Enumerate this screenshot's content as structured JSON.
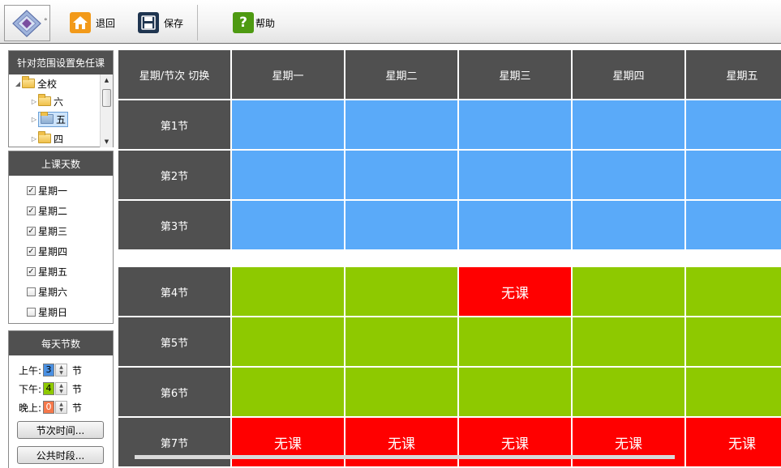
{
  "toolbar": {
    "back_label": "退回",
    "save_label": "保存",
    "help_label": "帮助",
    "logo_dot": "°"
  },
  "scope_panel": {
    "title": "针对范围设置免任课",
    "tree": [
      {
        "label": "全校",
        "level": 0,
        "expanded": true,
        "selected": false
      },
      {
        "label": "六",
        "level": 1,
        "expanded": false,
        "selected": false
      },
      {
        "label": "五",
        "level": 1,
        "expanded": false,
        "selected": true
      },
      {
        "label": "四",
        "level": 1,
        "expanded": false,
        "selected": false
      }
    ]
  },
  "days_panel": {
    "title": "上课天数",
    "days": [
      {
        "label": "星期一",
        "checked": true
      },
      {
        "label": "星期二",
        "checked": true
      },
      {
        "label": "星期三",
        "checked": true
      },
      {
        "label": "星期四",
        "checked": true
      },
      {
        "label": "星期五",
        "checked": true
      },
      {
        "label": "星期六",
        "checked": false
      },
      {
        "label": "星期日",
        "checked": false
      }
    ]
  },
  "periods_panel": {
    "title": "每天节数",
    "unit": "节",
    "rows": [
      {
        "label": "上午:",
        "value": "3",
        "color": "#4a90e2"
      },
      {
        "label": "下午:",
        "value": "4",
        "color": "#8ec900"
      },
      {
        "label": "晚上:",
        "value": "0",
        "color": "#f5784a"
      }
    ],
    "period_time_button": "节次时间...",
    "public_slot_button": "公共时段..."
  },
  "grid": {
    "corner_label": "星期/节次 切换",
    "columns": [
      "星期一",
      "星期二",
      "星期三",
      "星期四",
      "星期五"
    ],
    "no_class_label": "无课",
    "colors": {
      "morning": "#5aaaf9",
      "afternoon": "#8ec900",
      "no_class": "#ff0000",
      "header": "#505050"
    },
    "rows": [
      {
        "label": "第1节",
        "block": "morning",
        "cells": [
          "",
          "",
          "",
          "",
          ""
        ]
      },
      {
        "label": "第2节",
        "block": "morning",
        "cells": [
          "",
          "",
          "",
          "",
          ""
        ]
      },
      {
        "label": "第3节",
        "block": "morning",
        "cells": [
          "",
          "",
          "",
          "",
          ""
        ]
      },
      {
        "label": "第4节",
        "block": "afternoon",
        "cells": [
          "",
          "",
          "无课",
          "",
          ""
        ]
      },
      {
        "label": "第5节",
        "block": "afternoon",
        "cells": [
          "",
          "",
          "",
          "",
          ""
        ]
      },
      {
        "label": "第6节",
        "block": "afternoon",
        "cells": [
          "",
          "",
          "",
          "",
          ""
        ]
      },
      {
        "label": "第7节",
        "block": "afternoon",
        "cells": [
          "无课",
          "无课",
          "无课",
          "无课",
          "无课"
        ]
      }
    ]
  }
}
